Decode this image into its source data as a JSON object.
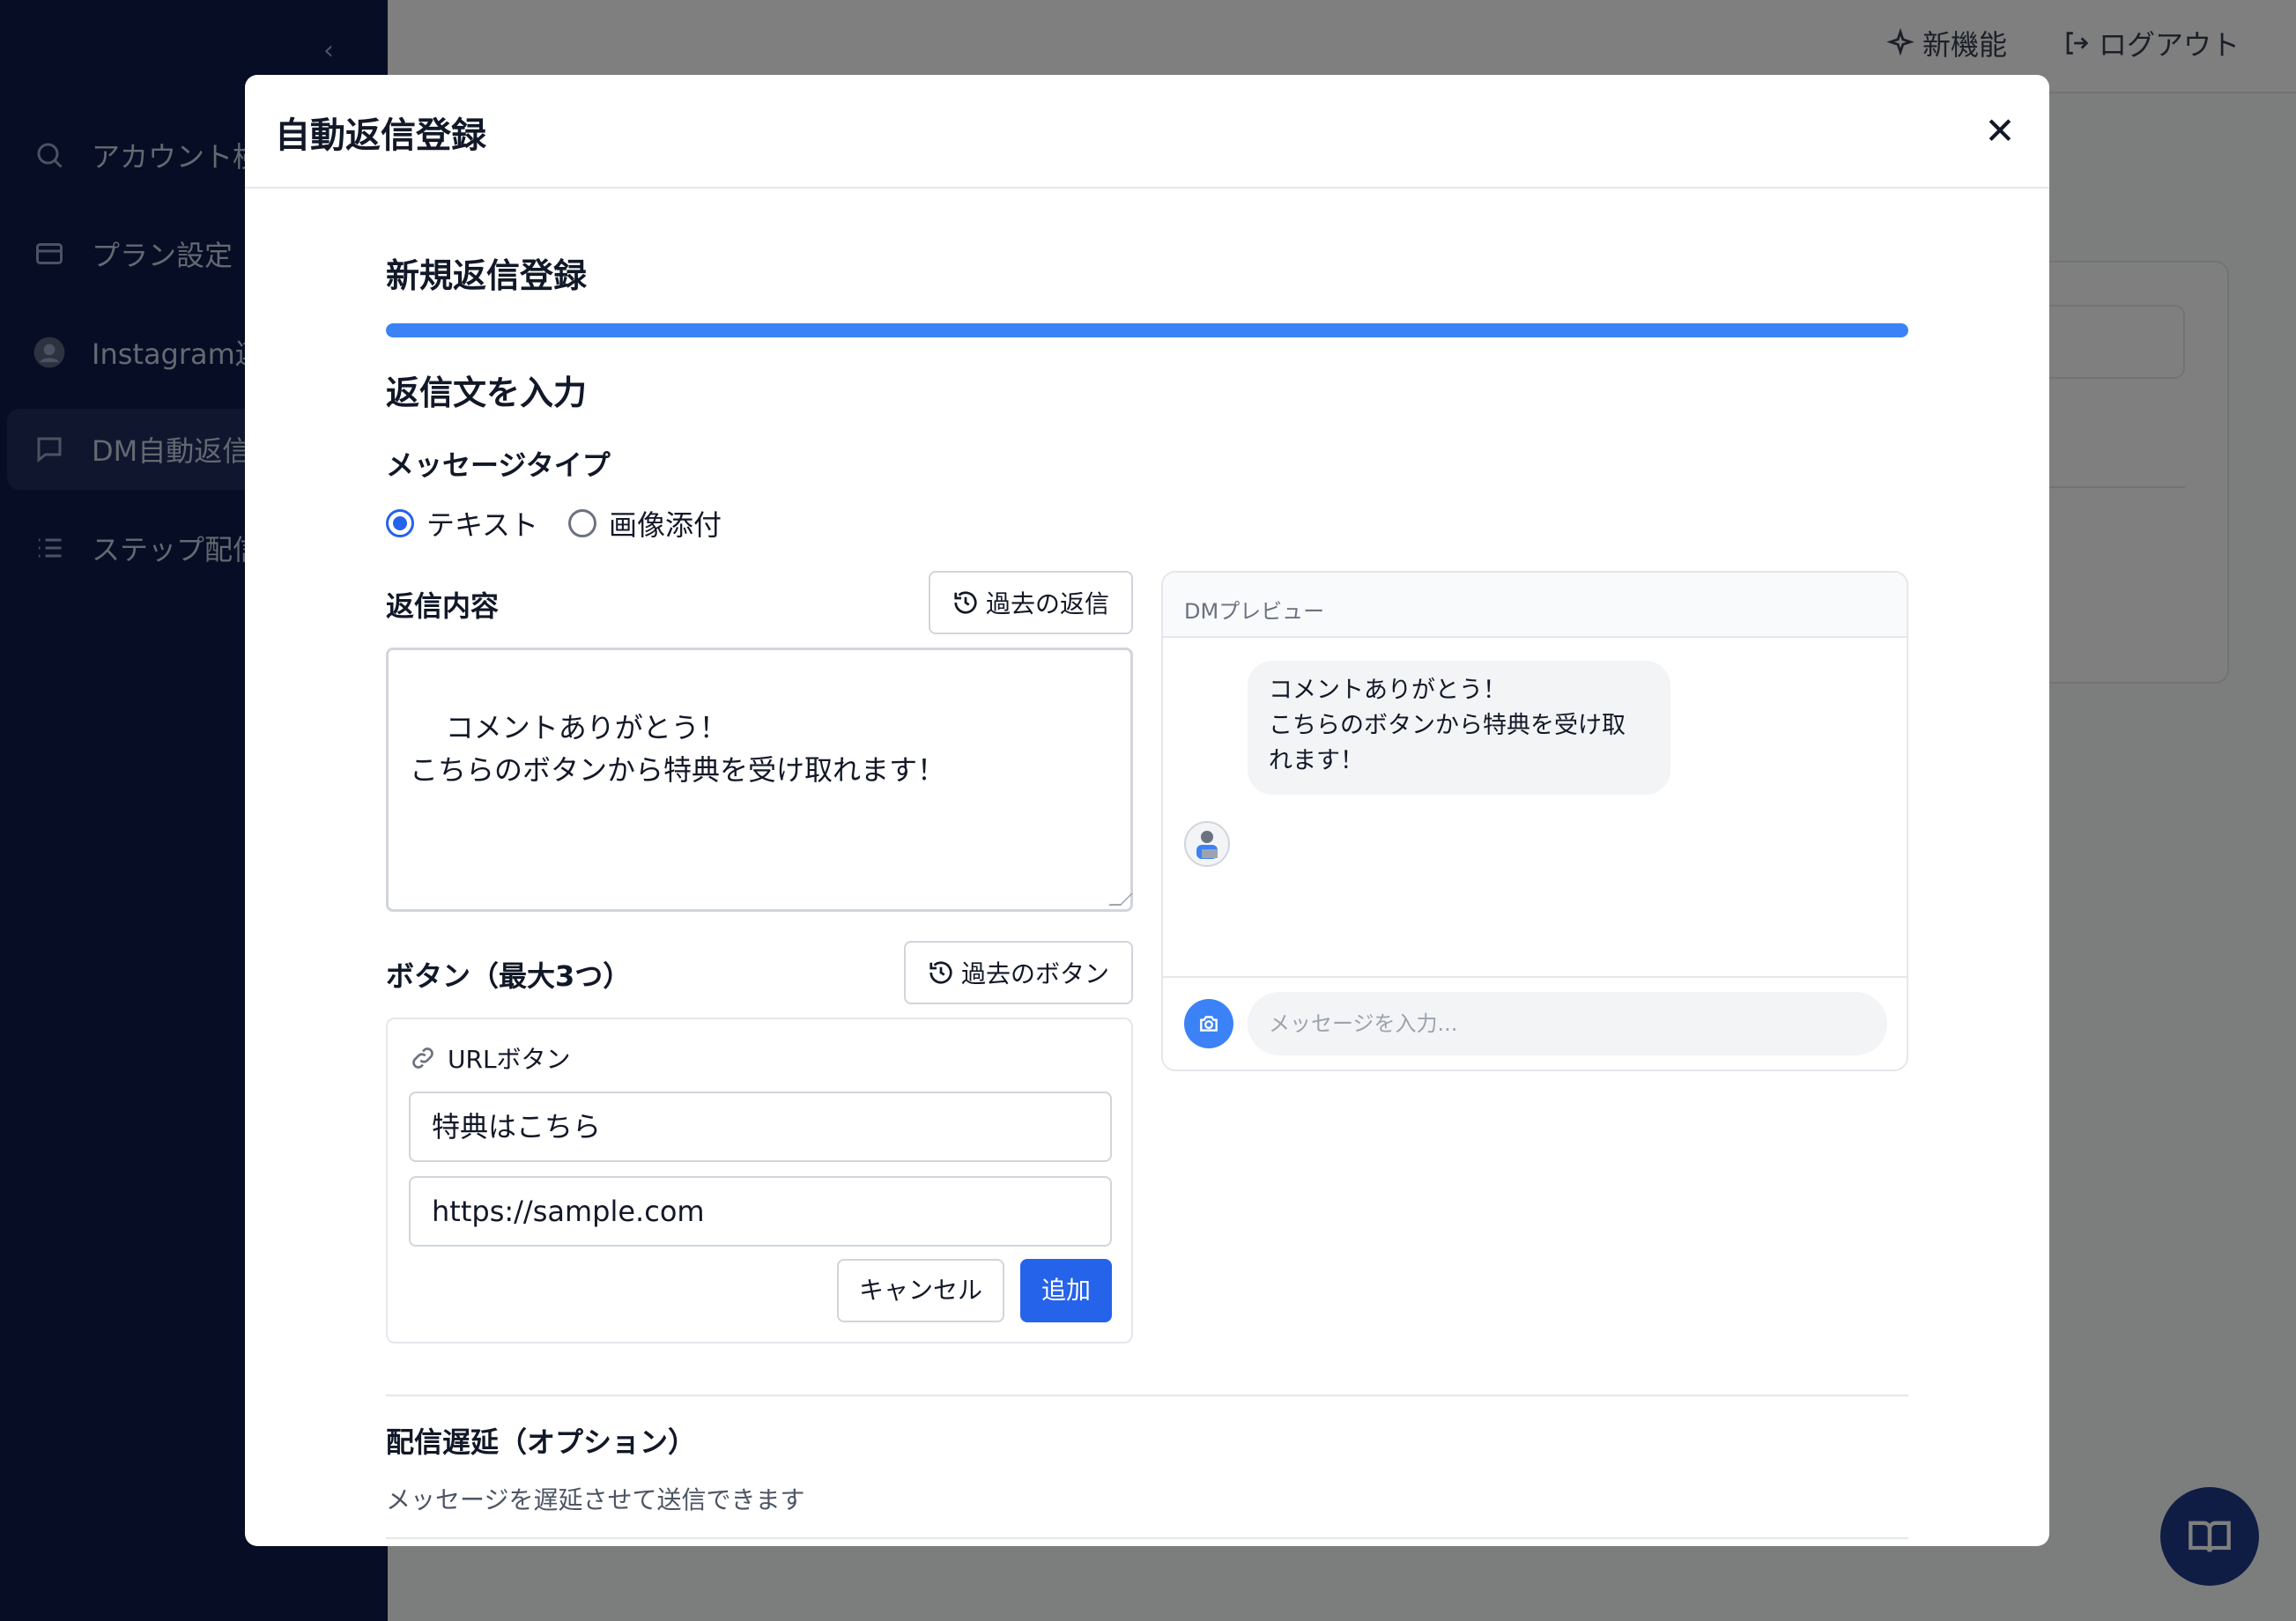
{
  "sidebar": {
    "items": [
      {
        "label": "アカウント検索",
        "icon": "search-icon"
      },
      {
        "label": "プラン設定",
        "icon": "card-icon"
      },
      {
        "label": "Instagram連携",
        "icon": "avatar-icon"
      },
      {
        "label": "DM自動返信",
        "icon": "chat-icon",
        "active": true
      },
      {
        "label": "ステップ配信",
        "icon": "list-icon"
      }
    ]
  },
  "header": {
    "new_features": "新機能",
    "logout": "ログアウト"
  },
  "modal": {
    "title": "自動返信登録",
    "section_title": "新規返信登録",
    "progress": 1.0,
    "step_title": "返信文を入力",
    "message_type": {
      "label": "メッセージタイプ",
      "options": [
        "テキスト",
        "画像添付"
      ],
      "selected": "テキスト"
    },
    "reply_content": {
      "label": "返信内容",
      "history_button": "過去の返信",
      "value": "コメントありがとう！\nこちらのボタンから特典を受け取れます！"
    },
    "buttons": {
      "label": "ボタン（最大3つ）",
      "history_button": "過去のボタン",
      "url_button": {
        "title": "URLボタン",
        "text_value": "特典はこちら",
        "url_value": "https://sample.com",
        "cancel": "キャンセル",
        "add": "追加"
      }
    },
    "preview": {
      "title": "DMプレビュー",
      "message": "コメントありがとう！\nこちらのボタンから特典を受け取\nれます！",
      "input_placeholder": "メッセージを入力..."
    },
    "delay": {
      "title": "配信遅延（オプション）",
      "description": "メッセージを遅延させて送信できます"
    }
  },
  "colors": {
    "sidebar_bg": "#0c1b4a",
    "accent": "#2563eb",
    "progress": "#3b82f6"
  }
}
